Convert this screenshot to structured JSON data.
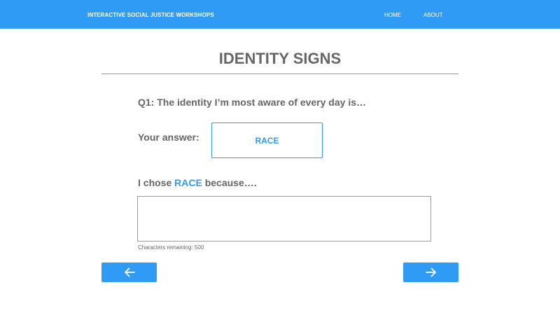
{
  "header": {
    "brand": "INTERACTIVE SOCIAL JUSTICE WORKSHOPS",
    "nav": [
      {
        "label": "HOME"
      },
      {
        "label": "ABOUT"
      }
    ],
    "background_color": "#2f9bf5"
  },
  "page": {
    "title": "IDENTITY SIGNS"
  },
  "question": {
    "text": "Q1: The identity I’m most aware of every day is…"
  },
  "answer": {
    "label": "Your answer:",
    "value": "RACE"
  },
  "reason": {
    "prefix": "I chose",
    "choice": "RACE",
    "suffix": "because….",
    "input_value": "",
    "chars_remaining_text": "Characters remaining: 500"
  },
  "buttons": {
    "back_icon": "arrow-left-icon",
    "next_icon": "arrow-right-icon"
  },
  "colors": {
    "accent": "#2f9bf5",
    "text": "#666666"
  }
}
